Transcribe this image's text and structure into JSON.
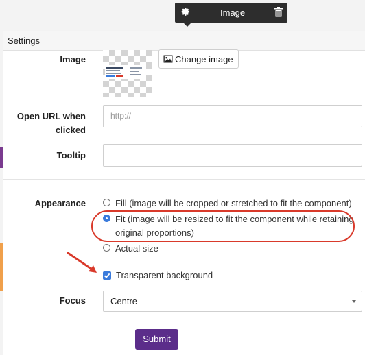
{
  "toolbar": {
    "title": "Image",
    "settings_icon": "gear-icon",
    "delete_icon": "trash-icon"
  },
  "panel": {
    "title": "Settings"
  },
  "image_field": {
    "label": "Image",
    "change_button_label": "Change image",
    "change_button_icon": "image-icon"
  },
  "url_field": {
    "label_line1": "Open URL when",
    "label_line2": "clicked",
    "placeholder": "http://",
    "value": ""
  },
  "tooltip_field": {
    "label": "Tooltip",
    "value": ""
  },
  "appearance": {
    "label": "Appearance",
    "options": [
      {
        "text": "Fill (image will be cropped or stretched to fit the component)",
        "selected": false
      },
      {
        "text_line1": "Fit (image will be resized to fit the component while retaining",
        "text_line2": "original proportions)",
        "selected": true
      },
      {
        "text": "Actual size",
        "selected": false
      }
    ],
    "transparent_background": {
      "label": "Transparent background",
      "checked": true
    }
  },
  "focus": {
    "label": "Focus",
    "selected": "Centre"
  },
  "submit_label": "Submit",
  "colors": {
    "accent": "#3a7bdc",
    "submit": "#5b2d8a",
    "annotation": "#d93a2b",
    "toolbar": "#2d2d2d"
  }
}
